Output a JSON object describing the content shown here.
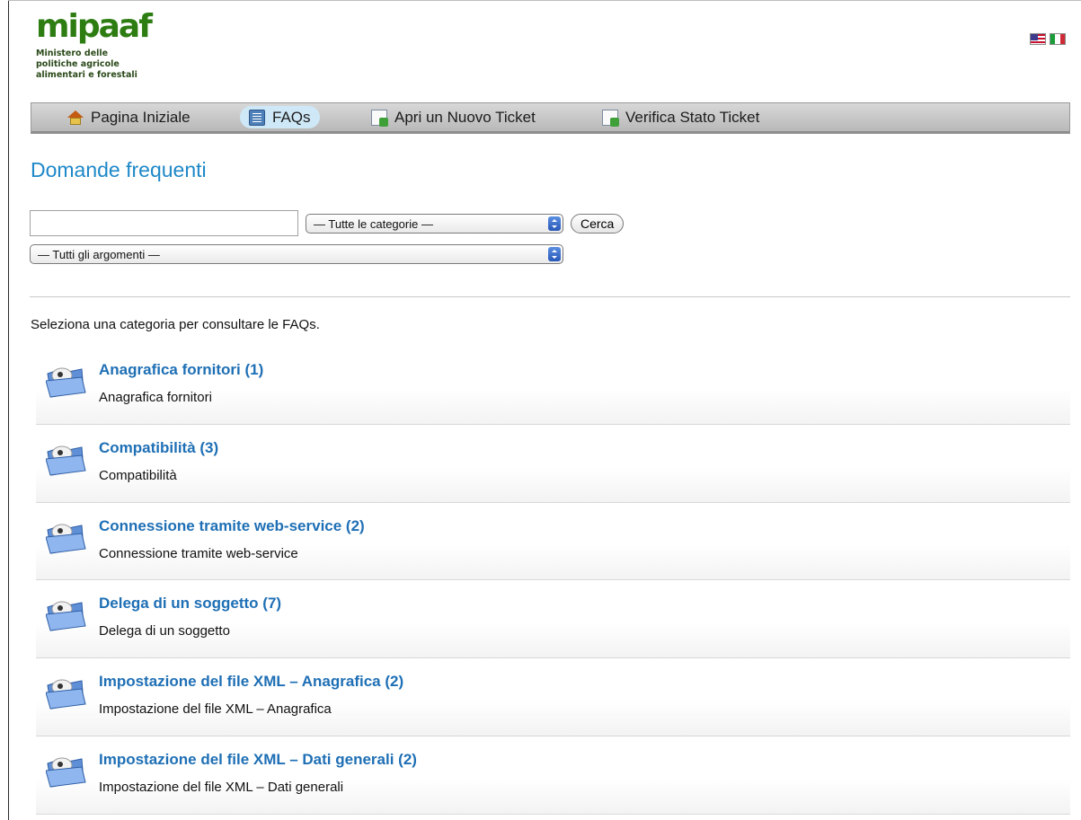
{
  "header": {
    "logo_text": "mipaaf",
    "logo_subtitle": [
      "Ministero delle",
      "politiche agricole",
      "alimentari e forestali"
    ],
    "flags": [
      {
        "name": "english-flag",
        "language": "English"
      },
      {
        "name": "italian-flag",
        "language": "Italiano"
      }
    ]
  },
  "nav": {
    "items": [
      {
        "label": "Pagina Iniziale",
        "icon": "home-icon",
        "active": false
      },
      {
        "label": "FAQs",
        "icon": "faq-book-icon",
        "active": true
      },
      {
        "label": "Apri un Nuovo Ticket",
        "icon": "new-ticket-icon",
        "active": false
      },
      {
        "label": "Verifica Stato Ticket",
        "icon": "ticket-status-icon",
        "active": false
      }
    ]
  },
  "page": {
    "title": "Domande frequenti",
    "search": {
      "value": "",
      "category_select": "— Tutte le categorie —",
      "topic_select": "— Tutti gli argomenti —",
      "button_label": "Cerca"
    },
    "intro": "Seleziona una categoria per consultare le FAQs."
  },
  "categories": [
    {
      "title": "Anagrafica fornitori (1)",
      "description": "Anagrafica fornitori"
    },
    {
      "title": "Compatibilità (3)",
      "description": "Compatibilità"
    },
    {
      "title": "Connessione tramite web-service (2)",
      "description": "Connessione tramite web-service"
    },
    {
      "title": "Delega di un soggetto (7)",
      "description": "Delega di un soggetto"
    },
    {
      "title": "Impostazione del file XML – Anagrafica (2)",
      "description": "Impostazione del file XML – Anagrafica"
    },
    {
      "title": "Impostazione del file XML – Dati generali (2)",
      "description": "Impostazione del file XML – Dati generali"
    }
  ],
  "colors": {
    "logo_green": "#2e7d12",
    "title_blue": "#1e88c8",
    "link_blue": "#1e6fb5",
    "active_tab": "#cfe8f7"
  }
}
